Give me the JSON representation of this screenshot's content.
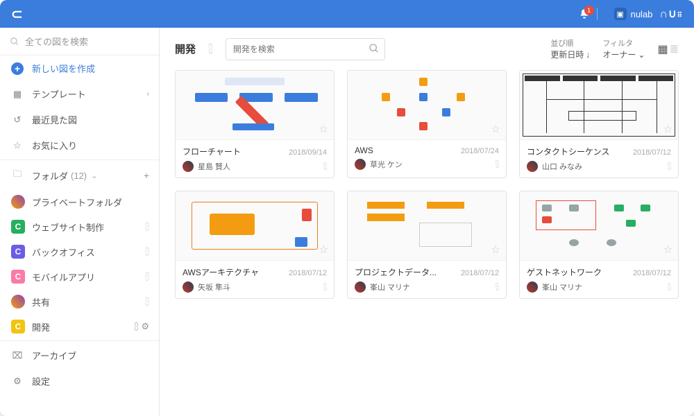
{
  "topbar": {
    "notif_count": "1",
    "brand_text": "nulab",
    "brand_logo": "nu"
  },
  "sidebar": {
    "search_placeholder": "全ての図を検索",
    "create_label": "新しい図を作成",
    "template_label": "テンプレート",
    "recent_label": "最近見た図",
    "favorite_label": "お気に入り",
    "folders_label": "フォルダ",
    "folders_count": "(12)",
    "private_label": "プライベートフォルダ",
    "archive_label": "アーカイブ",
    "settings_label": "設定",
    "folders": [
      {
        "label": "ウェブサイト制作",
        "color": "#27AE60"
      },
      {
        "label": "バックオフィス",
        "color": "#6C5CE7"
      },
      {
        "label": "モバイルアプリ",
        "color": "#FD79A8"
      },
      {
        "label": "共有",
        "avatar": true
      },
      {
        "label": "開発",
        "color": "#F1C40F",
        "active": true
      }
    ]
  },
  "main": {
    "title": "開発",
    "search_placeholder": "開発を検索",
    "sort_label": "並び順",
    "sort_value": "更新日時",
    "filter_label": "フィルタ",
    "filter_value": "オーナー"
  },
  "cards": [
    {
      "title": "フローチャート",
      "date": "2018/09/14",
      "owner": "星島 賢人",
      "thumb": "flow"
    },
    {
      "title": "AWS",
      "date": "2018/07/24",
      "owner": "草光 ケン",
      "thumb": "aws"
    },
    {
      "title": "コンタクトシーケンス",
      "date": "2018/07/12",
      "owner": "山口 みなみ",
      "thumb": "seq"
    },
    {
      "title": "AWSアーキテクチャ",
      "date": "2018/07/12",
      "owner": "矢坂 隼斗",
      "thumb": "aws2"
    },
    {
      "title": "プロジェクトデータ...",
      "date": "2018/07/12",
      "owner": "峯山 マリナ",
      "thumb": "proj"
    },
    {
      "title": "ゲストネットワーク",
      "date": "2018/07/12",
      "owner": "峯山 マリナ",
      "thumb": "net"
    }
  ]
}
